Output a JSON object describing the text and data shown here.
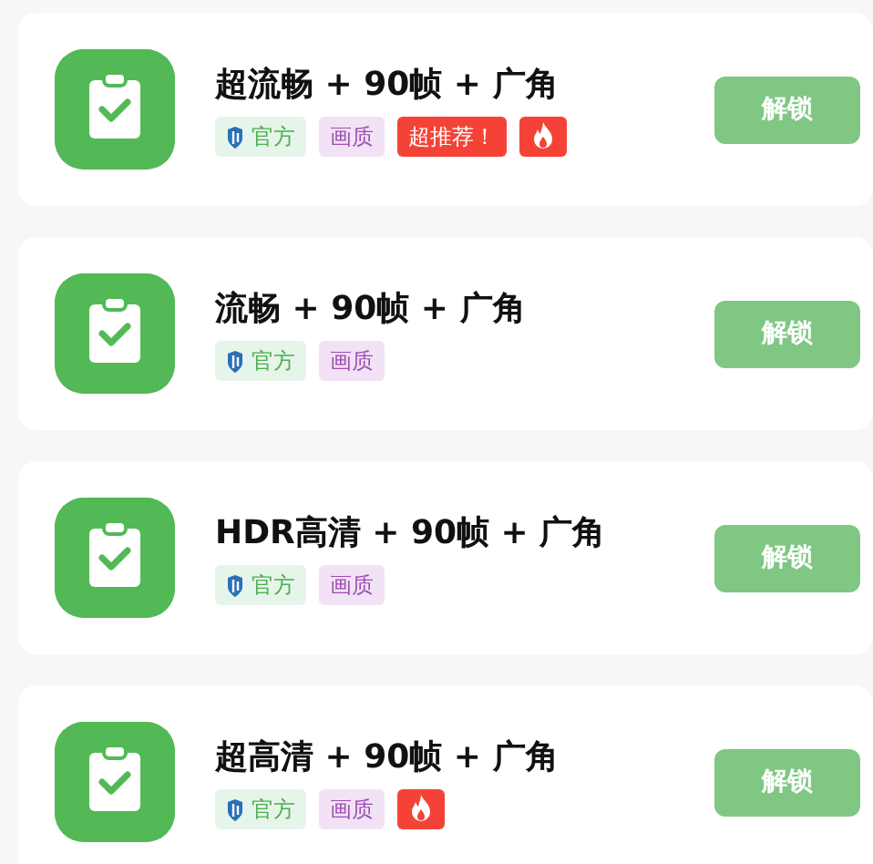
{
  "items": [
    {
      "title": "超流畅 + 90帧 + 广角",
      "tags": [
        {
          "kind": "official",
          "text": "官方"
        },
        {
          "kind": "quality",
          "text": "画质"
        },
        {
          "kind": "recommend",
          "text": "超推荐！"
        },
        {
          "kind": "hot"
        }
      ],
      "button": "解锁"
    },
    {
      "title": "流畅 + 90帧 + 广角",
      "tags": [
        {
          "kind": "official",
          "text": "官方"
        },
        {
          "kind": "quality",
          "text": "画质"
        }
      ],
      "button": "解锁"
    },
    {
      "title": "HDR高清 + 90帧 + 广角",
      "tags": [
        {
          "kind": "official",
          "text": "官方"
        },
        {
          "kind": "quality",
          "text": "画质"
        }
      ],
      "button": "解锁"
    },
    {
      "title": "超高清 + 90帧 + 广角",
      "tags": [
        {
          "kind": "official",
          "text": "官方"
        },
        {
          "kind": "quality",
          "text": "画质"
        },
        {
          "kind": "hot"
        }
      ],
      "button": "解锁"
    }
  ]
}
